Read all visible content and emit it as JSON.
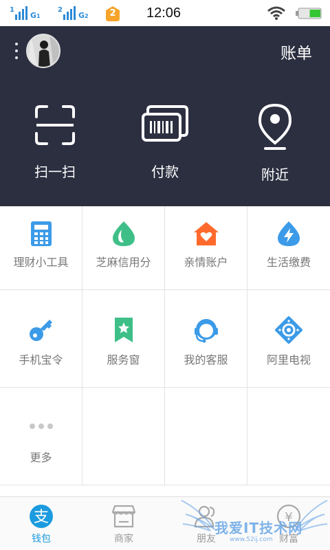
{
  "status_bar": {
    "time": "12:06",
    "sim1_label": "G",
    "sim1_index": "1",
    "sim2_label": "G",
    "sim2_index": "2",
    "sim1_slot": "1",
    "sim2_slot": "2",
    "notification_count": "2",
    "battery_level": 0.5
  },
  "header": {
    "bill_label": "账单"
  },
  "top_actions": [
    {
      "label": "扫一扫",
      "icon": "scan-icon"
    },
    {
      "label": "付款",
      "icon": "barcode-pay-icon"
    },
    {
      "label": "附近",
      "icon": "location-pin-icon"
    }
  ],
  "grid": {
    "row1": [
      {
        "label": "理财小工具",
        "icon": "calculator-icon",
        "color": "#3c9be8"
      },
      {
        "label": "芝麻信用分",
        "icon": "sesame-drop-icon",
        "color": "#3fbf88"
      },
      {
        "label": "亲情账户",
        "icon": "family-house-icon",
        "color": "#ff6a2c"
      },
      {
        "label": "生活缴费",
        "icon": "utility-drop-icon",
        "color": "#3c9be8"
      }
    ],
    "row2": [
      {
        "label": "手机宝令",
        "icon": "key-icon",
        "color": "#3c9be8"
      },
      {
        "label": "服务窗",
        "icon": "bookmark-star-icon",
        "color": "#3fbf88"
      },
      {
        "label": "我的客服",
        "icon": "headset-service-icon",
        "color": "#3c9be8"
      },
      {
        "label": "阿里电视",
        "icon": "tv-remote-icon",
        "color": "#3c9be8"
      }
    ],
    "row3": [
      {
        "label": "更多",
        "icon": "more-dots-icon"
      }
    ]
  },
  "tabbar": [
    {
      "label": "钱包",
      "icon": "alipay-wallet-icon",
      "glyph": "支",
      "active": true
    },
    {
      "label": "商家",
      "icon": "store-icon",
      "active": false
    },
    {
      "label": "朋友",
      "icon": "friends-icon",
      "active": false
    },
    {
      "label": "财富",
      "icon": "wealth-yen-icon",
      "glyph": "¥",
      "active": false
    }
  ],
  "watermark": {
    "text": "我爱IT技术网",
    "url": "www.52ij.com"
  },
  "colors": {
    "header_bg": "#2c2f40",
    "accent_blue": "#1c9bdf",
    "green": "#3fbf88",
    "orange": "#ff6a2c"
  }
}
